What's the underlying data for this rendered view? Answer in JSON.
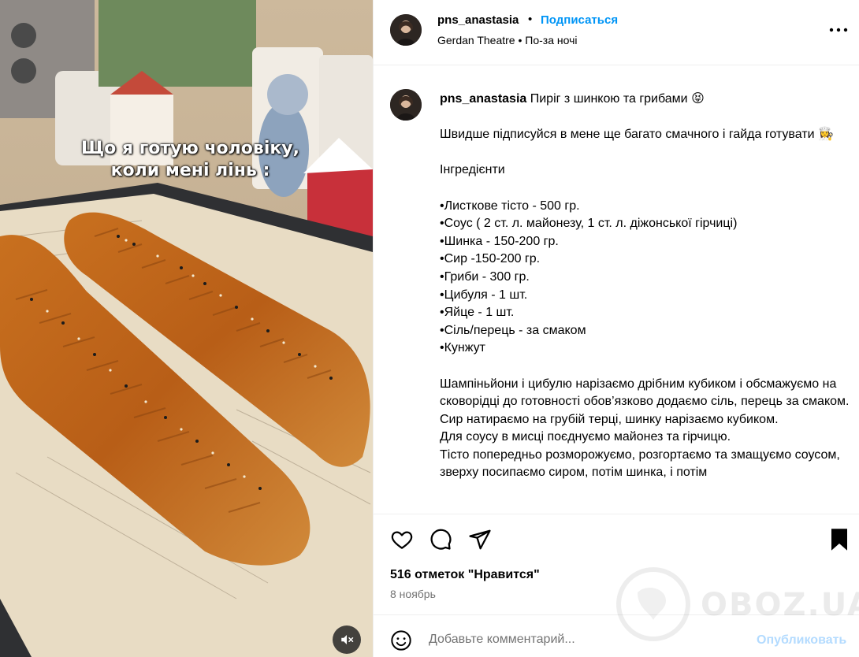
{
  "media": {
    "overlay_line1": "Що я готую чоловіку,",
    "overlay_line2": "коли мені лінь :",
    "mute_icon": "speaker-muted-icon"
  },
  "header": {
    "username": "pns_anastasia",
    "separator": "•",
    "follow_label": "Подписаться",
    "audio": "Gerdan Theatre • По-за ночі"
  },
  "caption": {
    "username": "pns_anastasia",
    "title": "Пиріг з шинкою та грибами 😝",
    "body": "Швидше підписуйся в мене ще багато смачного і гайда готувати 👩‍🍳\n\nІнгредієнти\n\n•Листкове тісто - 500 гр.\n•Соус ( 2 ст. л. майонезу, 1 ст. л. діжонської гірчиці)\n•Шинка - 150-200 гр.\n•Сир -150-200 гр.\n•Гриби - 300 гр.\n•Цибуля - 1 шт.\n•Яйце - 1 шт.\n•Сіль/перець - за смаком\n•Кунжут\n\nШампіньйони і цибулю нарізаємо дрібним кубиком і обсмажуємо на сковорідці до готовності обов’язково додаємо сіль, перець за смаком.\nСир натираємо на грубій терці, шинку нарізаємо кубиком.\nДля соусу в мисці поєднуємо майонез та гірчицю.\nТісто попередньо розморожуємо, розгортаємо та змащуємо соусом, зверху посипаємо сиром, потім шинка, і потім"
  },
  "actions": {
    "likes": "516 отметок \"Нравится\"",
    "date": "8 ноябрь"
  },
  "comment": {
    "placeholder": "Добавьте комментарий...",
    "post_label": "Опубликовать"
  },
  "watermark": {
    "text": "OBOZ.UA"
  },
  "colors": {
    "link": "#0095f6",
    "post_disabled": "#b3dbff",
    "secondary_text": "#737373",
    "divider": "#efefef"
  }
}
